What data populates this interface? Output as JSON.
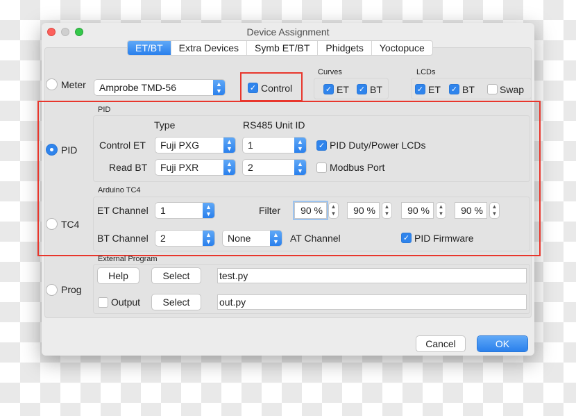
{
  "window": {
    "title": "Device Assignment"
  },
  "tabs": [
    {
      "label": "ET/BT",
      "selected": true
    },
    {
      "label": "Extra Devices"
    },
    {
      "label": "Symb ET/BT"
    },
    {
      "label": "Phidgets"
    },
    {
      "label": "Yoctopuce"
    }
  ],
  "meter": {
    "label": "Meter",
    "device": "Amprobe TMD-56",
    "control_label": "Control",
    "control_checked": true
  },
  "curves": {
    "title": "Curves",
    "et": "ET",
    "bt": "BT",
    "et_checked": true,
    "bt_checked": true
  },
  "lcds": {
    "title": "LCDs",
    "et": "ET",
    "bt": "BT",
    "swap": "Swap",
    "et_checked": true,
    "bt_checked": true,
    "swap_checked": false
  },
  "pid": {
    "radio_label": "PID",
    "selected": true,
    "group": "PID",
    "type_header": "Type",
    "unit_header": "RS485 Unit ID",
    "control_et_label": "Control ET",
    "control_et_type": "Fuji PXG",
    "control_et_unit": "1",
    "read_bt_label": "Read BT",
    "read_bt_type": "Fuji PXR",
    "read_bt_unit": "2",
    "duty_lcds": "PID Duty/Power LCDs",
    "duty_lcds_checked": true,
    "modbus": "Modbus Port",
    "modbus_checked": false
  },
  "tc4": {
    "radio_label": "TC4",
    "group": "Arduino TC4",
    "et_channel_label": "ET Channel",
    "et_channel": "1",
    "filter_label": "Filter",
    "filters": [
      "90 %",
      "90 %",
      "90 %",
      "90 %"
    ],
    "bt_channel_label": "BT Channel",
    "bt_channel": "2",
    "at_channel": "None",
    "at_channel_label": "AT Channel",
    "pid_firmware": "PID Firmware",
    "pid_firmware_checked": true
  },
  "prog": {
    "radio_label": "Prog",
    "group": "External Program",
    "help": "Help",
    "select1": "Select",
    "program": "test.py",
    "output": "Output",
    "output_checked": false,
    "select2": "Select",
    "output_file": "out.py"
  },
  "footer": {
    "cancel": "Cancel",
    "ok": "OK"
  },
  "colors": {
    "accent": "#2f84ec",
    "highlight": "#e8362c"
  }
}
